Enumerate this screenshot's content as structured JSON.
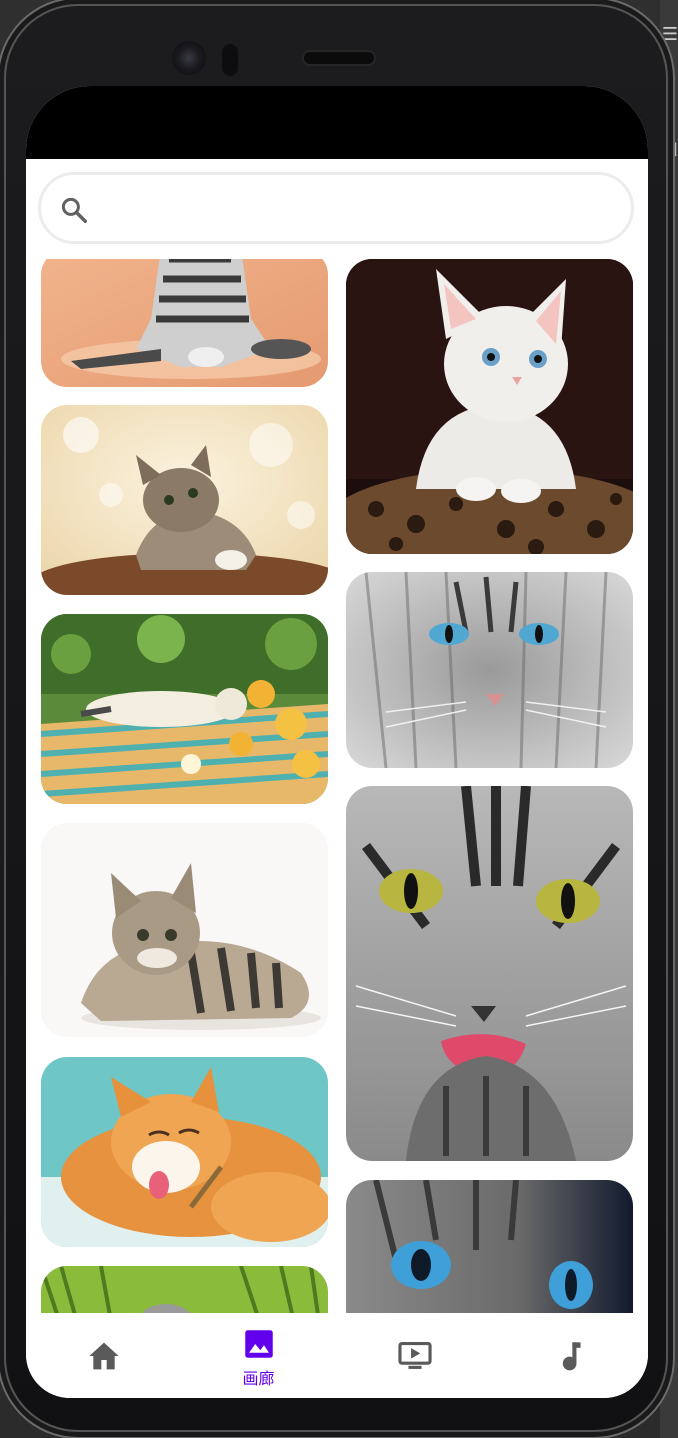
{
  "search": {
    "placeholder": "",
    "value": ""
  },
  "gallery": {
    "images": [
      {
        "name": "cat-tabby-sitting"
      },
      {
        "name": "kitten-looking-up"
      },
      {
        "name": "cat-sleeping-on-bench"
      },
      {
        "name": "kitten-lying-down"
      },
      {
        "name": "orange-cat-licking"
      },
      {
        "name": "cat-in-grass"
      },
      {
        "name": "white-kitten-on-leopard-bed"
      },
      {
        "name": "gray-cat-blue-eyes"
      },
      {
        "name": "tabby-cat-licking-paw"
      },
      {
        "name": "cat-blue-eyes-closeup"
      }
    ]
  },
  "bottom_nav": {
    "items": [
      {
        "label": "",
        "icon": "home-icon",
        "active": false
      },
      {
        "label": "画廊",
        "icon": "image-icon",
        "active": true
      },
      {
        "label": "",
        "icon": "slideshow-icon",
        "active": false
      },
      {
        "label": "",
        "icon": "music-note-icon",
        "active": false
      }
    ]
  },
  "colors": {
    "accent": "#6200ee",
    "inactive_icon": "#5a5a5a",
    "status_bar": "#000000"
  }
}
